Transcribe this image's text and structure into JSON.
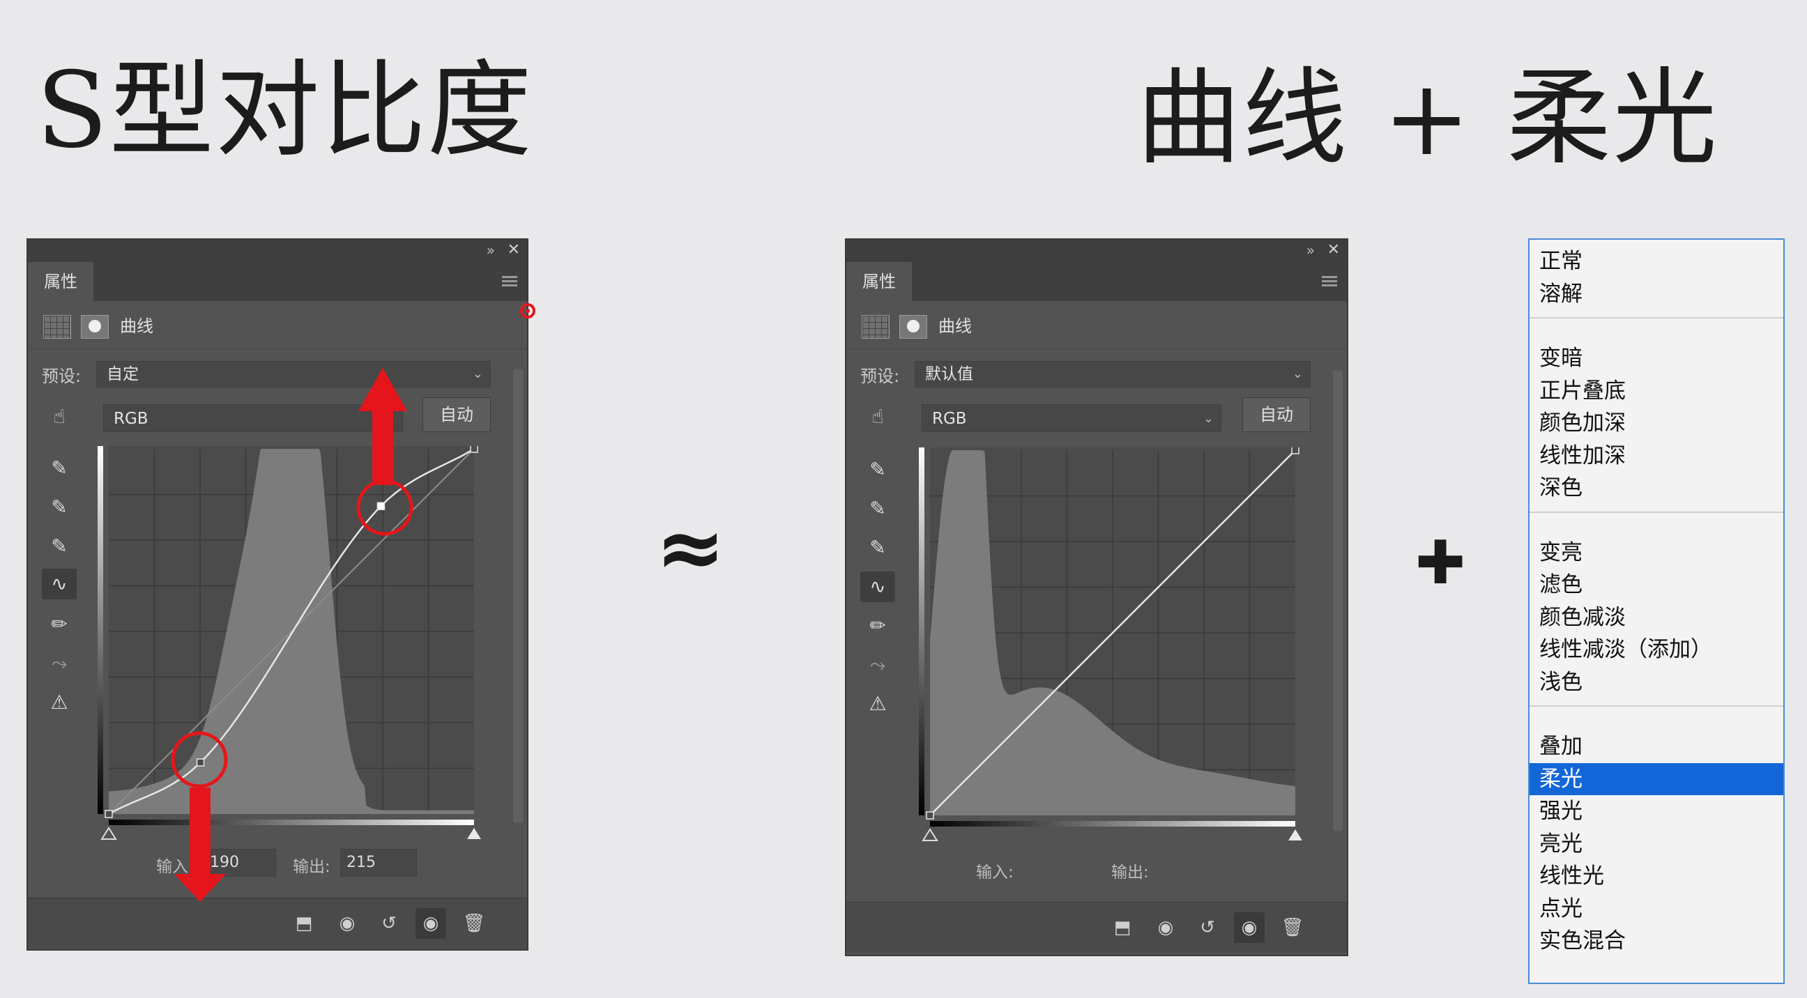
{
  "left_title": "S型对比度",
  "right_title": "曲线 + 柔光",
  "approx_symbol": "≈",
  "plus_symbol": "✚",
  "panels": [
    {
      "tab_label": "属性",
      "adjustment_label": "曲线",
      "preset_label": "预设:",
      "preset_value": "自定",
      "channel_value": "RGB",
      "auto_button": "自动",
      "input_label": "输入:",
      "input_value": "190",
      "output_label": "输出:",
      "output_value": "215",
      "curve_points": [
        [
          0,
          0
        ],
        [
          64,
          36
        ],
        [
          190,
          215
        ],
        [
          255,
          255
        ]
      ]
    },
    {
      "tab_label": "属性",
      "adjustment_label": "曲线",
      "preset_label": "预设:",
      "preset_value": "默认值",
      "channel_value": "RGB",
      "auto_button": "自动",
      "input_label": "输入:",
      "input_value": "",
      "output_label": "输出:",
      "output_value": "",
      "curve_points": [
        [
          0,
          0
        ],
        [
          255,
          255
        ]
      ]
    }
  ],
  "blend_mode_groups": [
    [
      "正常",
      "溶解"
    ],
    [
      "变暗",
      "正片叠底",
      "颜色加深",
      "线性加深",
      "深色"
    ],
    [
      "变亮",
      "滤色",
      "颜色减淡",
      "线性减淡（添加）",
      "浅色"
    ],
    [
      "叠加",
      "柔光",
      "强光",
      "亮光",
      "线性光",
      "点光",
      "实色混合"
    ]
  ],
  "blend_mode_selected": "柔光",
  "colors": {
    "panel_bg": "#535353",
    "arrow_red": "#e5161b",
    "selection_blue": "#1366d8"
  }
}
